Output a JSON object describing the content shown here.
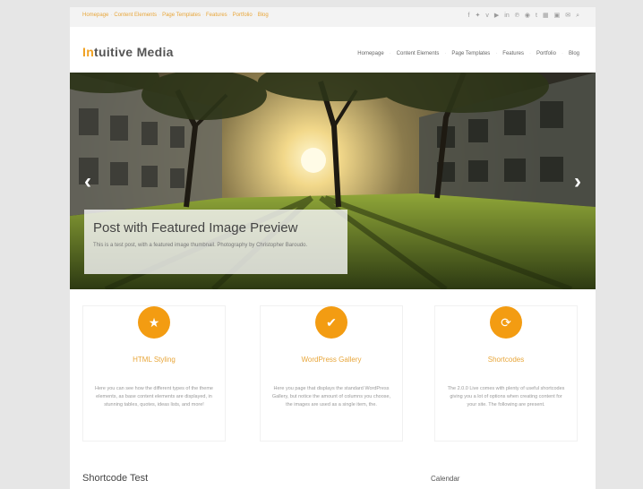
{
  "topbar": {
    "links": [
      "Homepage",
      "Content Elements",
      "Page Templates",
      "Features",
      "Portfolio",
      "Blog"
    ],
    "social_icons": [
      "facebook-icon",
      "twitter-icon",
      "vimeo-icon",
      "youtube-icon",
      "linkedin-icon",
      "pinterest-icon",
      "rss-icon",
      "tumblr-icon",
      "flickr-icon",
      "instagram-icon",
      "email-icon",
      "search-icon"
    ]
  },
  "header": {
    "logo_accent": "In",
    "logo_rest": "tuitive Media",
    "nav": [
      "Homepage",
      "Content Elements",
      "Page Templates",
      "Features",
      "Portfolio",
      "Blog"
    ]
  },
  "hero": {
    "title": "Post with Featured Image Preview",
    "text": "This is a test post, with a featured image thumbnail. Photography by Christopher Baroudo.",
    "prev_label": "‹",
    "next_label": "›"
  },
  "features": [
    {
      "icon": "star-icon",
      "glyph": "★",
      "title": "HTML Styling",
      "text": "Here you can see how the different types of the theme elements, as base content elements are displayed, in stunning tables, quotes, ideas lists, and more!"
    },
    {
      "icon": "checkmark-icon",
      "glyph": "✔",
      "title": "WordPress Gallery",
      "text": "Here you page that displays the standard WordPress Gallery, but notice the amount of columns you choose, the images are used as a single item, the."
    },
    {
      "icon": "refresh-icon",
      "glyph": "⟳",
      "title": "Shortcodes",
      "text": "The 2.0.0 Live comes with plenty of useful shortcodes giving you a lot of options when creating content for your site. The following are present."
    }
  ],
  "bottom": {
    "left_heading": "Shortcode Test",
    "right_heading": "Calendar"
  },
  "colors": {
    "accent": "#f39c12",
    "link": "#e8a63a"
  }
}
